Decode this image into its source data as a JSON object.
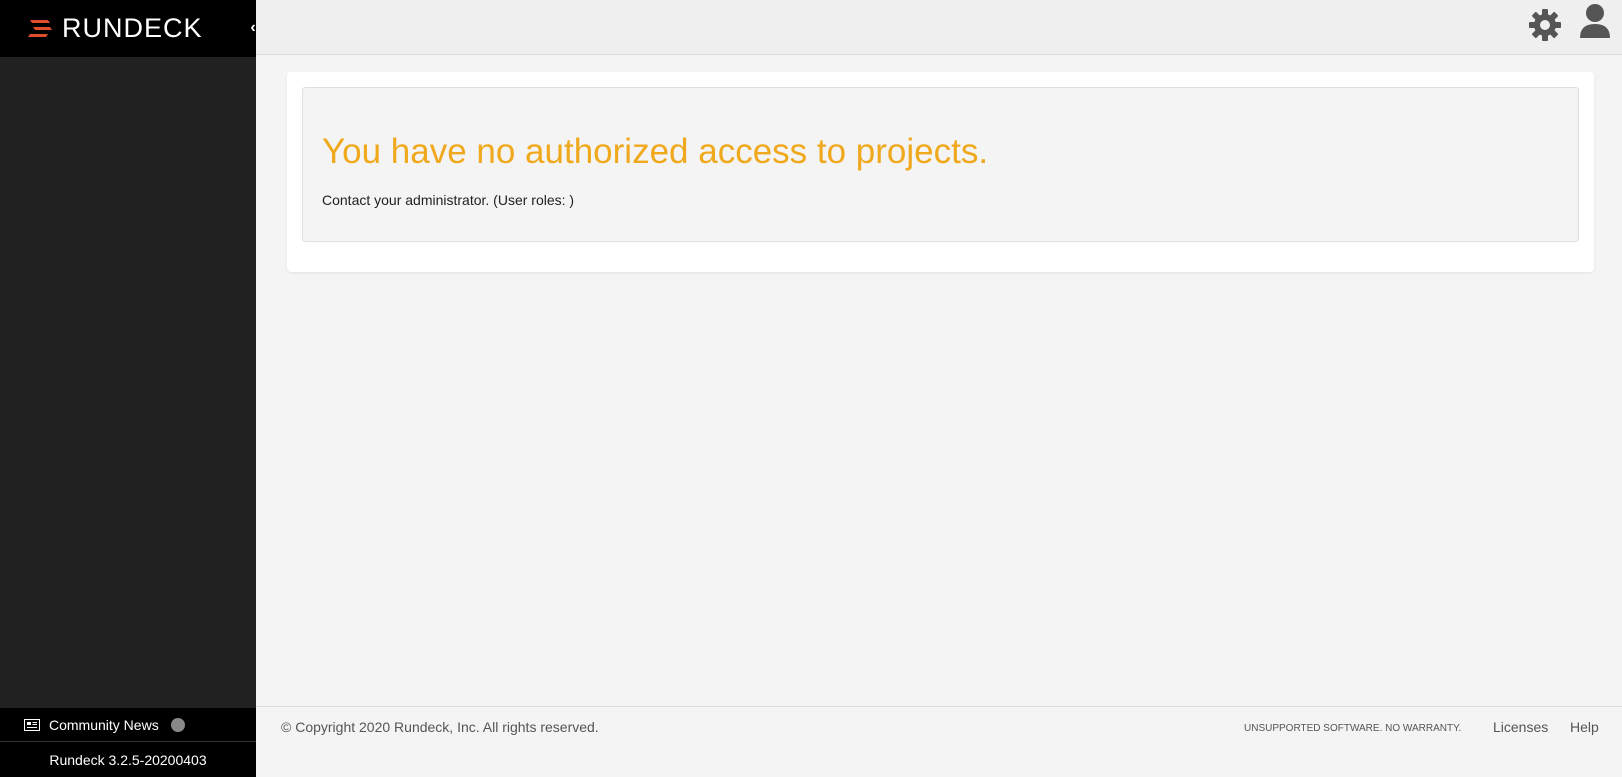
{
  "brand": {
    "name": "RUNDECK",
    "accent_color": "#e04e2b"
  },
  "sidebar": {
    "community_news": {
      "label": "Community News",
      "icon": "newspaper-icon",
      "status_dot_color": "#888888"
    },
    "version": "Rundeck 3.2.5-20200403"
  },
  "topbar": {
    "settings_icon": "gear-icon",
    "user_icon": "user-icon"
  },
  "main": {
    "alert_title": "You have no authorized access to projects.",
    "alert_text": "Contact your administrator. (User roles: )",
    "alert_color": "#f0a81c"
  },
  "footer": {
    "copyright": "© Copyright 2020 Rundeck, Inc. All rights reserved.",
    "warranty": "Unsupported Software. No Warranty.",
    "licenses_label": "Licenses",
    "help_label": "Help"
  }
}
